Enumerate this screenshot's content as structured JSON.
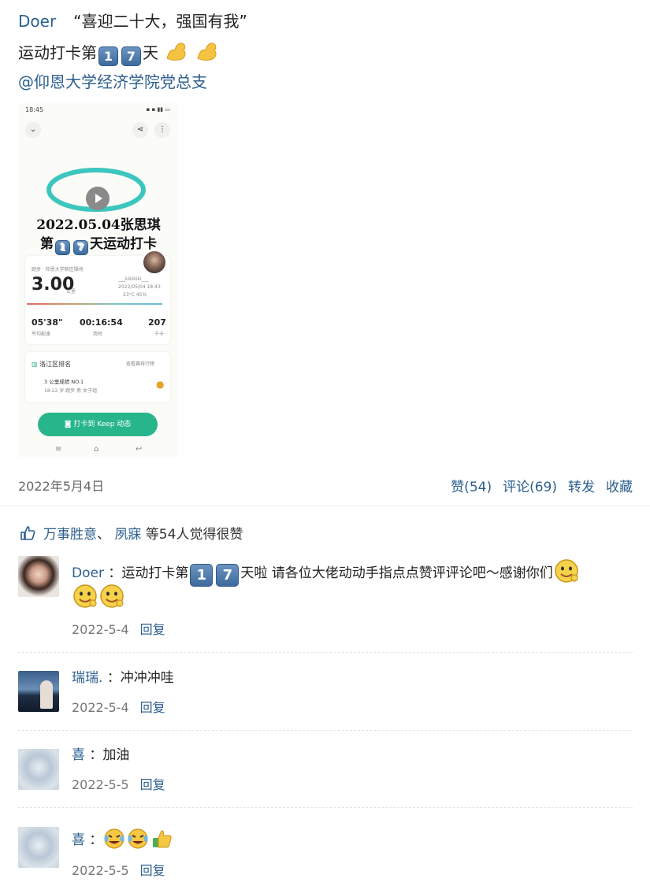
{
  "post": {
    "author": "Doer",
    "title": "“喜迎二十大，强国有我”",
    "line2_prefix": "运动打卡第",
    "day_digits": [
      "1",
      "7"
    ],
    "line2_suffix": "天",
    "mention": "@仰恩大学经济学院党总支",
    "date": "2022年5月4日"
  },
  "screenshot": {
    "status_time": "18:45",
    "overlay_line1": "2022.05.04张思琪",
    "overlay_prefix": "第",
    "overlay_digits": [
      "1",
      "7"
    ],
    "overlay_suffix": "天运动打卡",
    "subtitle": "跑步 · 仰恩大学新区操场",
    "distance": "3.00",
    "distance_unit": "公里",
    "user": "___kikikiki___",
    "datetime": "2022/05/04 18:43",
    "weather": "23°C  45%",
    "pace": "05'38\"",
    "pace_label": "平均配速",
    "duration": "00:16:54",
    "duration_label": "用时",
    "calories": "207",
    "calories_label": "千卡",
    "rank_title": "洛江区排名",
    "rank_link": "查看赛排行榜",
    "rank_line1": "3 公里成绩 NO.1",
    "rank_line2": "18-22 岁 跑步 男   女子组",
    "button": "打卡到 Keep 动态"
  },
  "actions": {
    "like": "赞(54)",
    "comment": "评论(69)",
    "share": "转发",
    "favorite": "收藏"
  },
  "likes": {
    "user1": "万事胜意",
    "sep": "、",
    "user2": "夙寐",
    "count_text": "等54人",
    "suffix": "觉得很赞"
  },
  "comments": [
    {
      "name": "Doer",
      "prefix": "：运动打卡第",
      "digits": [
        "1",
        "7"
      ],
      "text": "天啦 请各位大佬动动手指点点赞评评论吧～感谢你们",
      "date": "2022-5-4",
      "reply": "回复"
    },
    {
      "name": "瑞瑞.",
      "text": "：冲冲冲哇",
      "date": "2022-5-4",
      "reply": "回复"
    },
    {
      "name": "喜",
      "text": "：加油",
      "date": "2022-5-5",
      "reply": "回复"
    },
    {
      "name": "喜",
      "text": "：",
      "date": "2022-5-5",
      "reply": "回复"
    }
  ],
  "colors": {
    "link": "#2c5f8f",
    "keep_green": "#28b58b"
  }
}
